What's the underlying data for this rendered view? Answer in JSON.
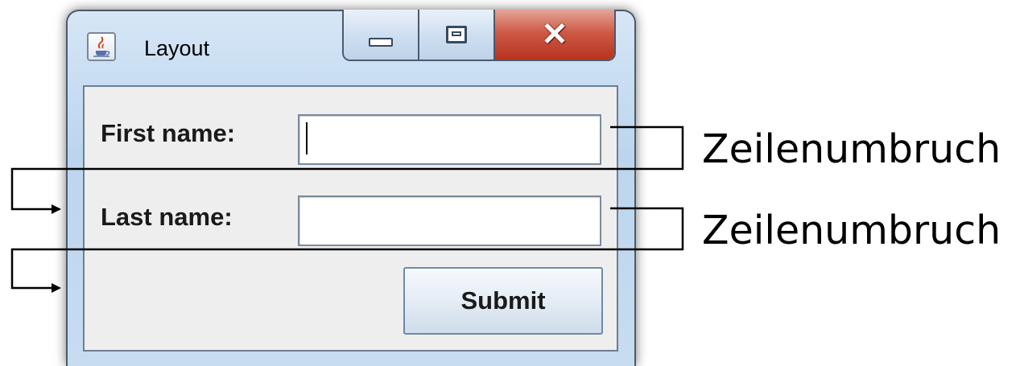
{
  "window": {
    "title": "Layout",
    "app_icon": "java-cup-icon",
    "controls": {
      "minimize": "minimize-icon",
      "maximize": "maximize-icon",
      "close": "close-icon"
    }
  },
  "form": {
    "first_name": {
      "label": "First name:",
      "value": ""
    },
    "last_name": {
      "label": "Last name:",
      "value": ""
    },
    "submit_label": "Submit"
  },
  "annotations": {
    "line_break_1": "Zeilenumbruch",
    "line_break_2": "Zeilenumbruch"
  }
}
